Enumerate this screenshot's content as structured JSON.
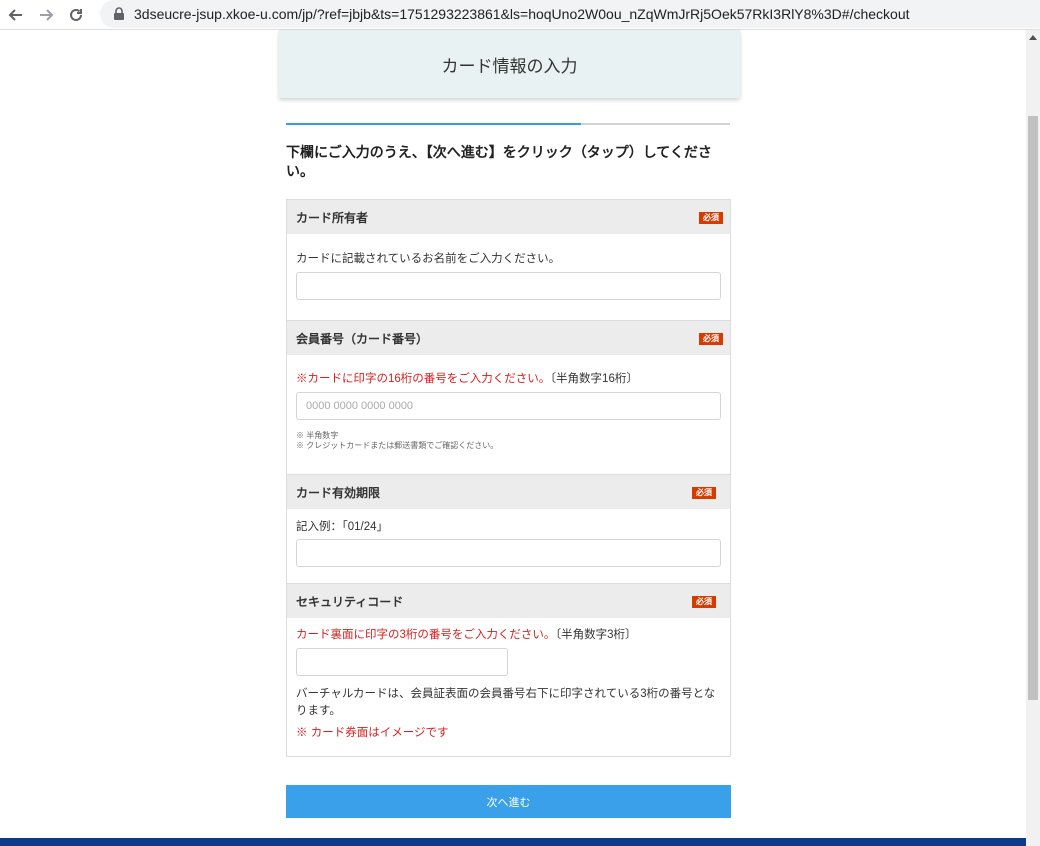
{
  "browser": {
    "url": "3dseucre-jsup.xkoe-u.com/jp/?ref=jbjb&ts=1751293223861&ls=hoqUno2W0ou_nZqWmJrRj5Oek57RkI3RlY8%3D#/checkout",
    "icons": [
      "back-arrow-icon",
      "forward-arrow-icon",
      "reload-icon",
      "lock-icon"
    ]
  },
  "header": {
    "title": "カード情報の入力"
  },
  "progress": {
    "fraction": 0.665
  },
  "instruction": "下欄にご入力のうえ、【次へ進む】をクリック（タップ）してください。",
  "form": {
    "required_badge": "必須",
    "holder": {
      "title": "カード所有者",
      "desc": "カードに記載されているお名前をご入力ください。",
      "value": ""
    },
    "number": {
      "title": "会員番号（カード番号）",
      "desc_red": "※カードに印字の16桁の番号をご入力ください。",
      "desc_tail": "〔半角数字16桁〕",
      "placeholder": "0000 0000 0000 0000",
      "note1": "※ 半角数字",
      "note2": "※ クレジットカードまたは郵送書類でご確認ください。"
    },
    "expiry": {
      "title": "カード有効期限",
      "desc": "記入例：「01/24」",
      "value": ""
    },
    "security": {
      "title": "セキュリティコード",
      "desc_red": "カード裏面に印字の3桁の番号をご入力ください。",
      "desc_tail": "〔半角数字3桁〕",
      "value": "",
      "para": "バーチャルカードは、会員証表面の会員番号右下に印字されている3桁の番号となります。",
      "note_red": "※ カード券面はイメージです"
    }
  },
  "next_button": {
    "label": "次へ進む"
  },
  "colors": {
    "accent": "#3aa0ea",
    "badge": "#d63b00",
    "error": "#d61f1f",
    "footer": "#0c3b8e"
  }
}
